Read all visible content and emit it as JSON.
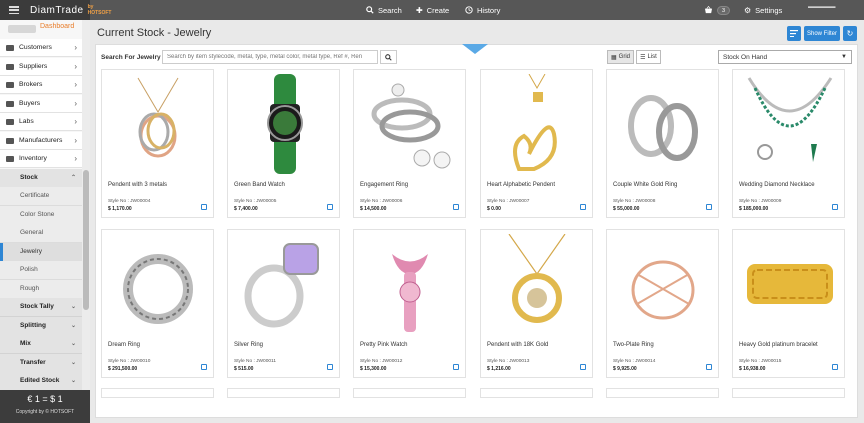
{
  "header": {
    "brand": "DiamTrade",
    "brand_sub": "by HOTSOFT",
    "nav": [
      {
        "label": "Search",
        "icon": "search-icon"
      },
      {
        "label": "Create",
        "icon": "plus-icon"
      },
      {
        "label": "History",
        "icon": "history-icon"
      }
    ],
    "cart_count": "3",
    "settings_label": "Settings"
  },
  "sidebar": {
    "dashboard_label": "Dashboard",
    "items": [
      {
        "label": "Customers"
      },
      {
        "label": "Suppliers"
      },
      {
        "label": "Brokers"
      },
      {
        "label": "Buyers"
      },
      {
        "label": "Labs"
      },
      {
        "label": "Manufacturers"
      },
      {
        "label": "Inventory"
      }
    ],
    "stock_section": "Stock",
    "stock_sub": [
      "Certificate",
      "Color Stone",
      "General",
      "Jewelry",
      "Polish",
      "Rough"
    ],
    "sections": [
      "Stock Tally",
      "Splitting",
      "Mix",
      "Transfer",
      "Edited Stock"
    ],
    "rate": "€ 1 = $ 1",
    "copyright": "Copyright by © HOTSOFT"
  },
  "main": {
    "title": "Current Stock - Jewelry",
    "show_filter": "Show Filter",
    "search_label": "Search For Jewelry",
    "search_placeholder": "Search by item stylecode, metal, type, metal color, metal type, Ref #, Ren",
    "grid_label": "Grid",
    "list_label": "List",
    "stock_select": "Stock On Hand"
  },
  "products": [
    {
      "name": "Pendent with 3 metals",
      "style": "Style No : JW00004",
      "price": "$ 1,170.00"
    },
    {
      "name": "Green Band Watch",
      "style": "Style No : JW00005",
      "price": "$ 7,400.00"
    },
    {
      "name": "Engagement Ring",
      "style": "Style No : JW00006",
      "price": "$ 14,500.00"
    },
    {
      "name": "Heart Alphabetic Pendent",
      "style": "Style No : JW00007",
      "price": "$ 0.00"
    },
    {
      "name": "Couple White Gold Ring",
      "style": "Style No : JW00008",
      "price": "$ 55,000.00"
    },
    {
      "name": "Wedding Diamond Necklace",
      "style": "Style No : JW00009",
      "price": "$ 185,000.00"
    },
    {
      "name": "Dream Ring",
      "style": "Style No : JW00010",
      "price": "$ 291,500.00"
    },
    {
      "name": "Silver Ring",
      "style": "Style No : JW00011",
      "price": "$ 515.00"
    },
    {
      "name": "Pretty Pink Watch",
      "style": "Style No : JW00012",
      "price": "$ 15,300.00"
    },
    {
      "name": "Pendent with 18K Gold",
      "style": "Style No : JW00013",
      "price": "$ 1,216.00"
    },
    {
      "name": "Two-Plate Ring",
      "style": "Style No : JW00014",
      "price": "$ 9,925.00"
    },
    {
      "name": "Heavy Gold platinum bracelet",
      "style": "Style No : JW00015",
      "price": "$ 16,938.00"
    }
  ],
  "colors": {
    "accent": "#2e86d4",
    "dashboard": "#e87d2a",
    "topbar": "#575757"
  }
}
